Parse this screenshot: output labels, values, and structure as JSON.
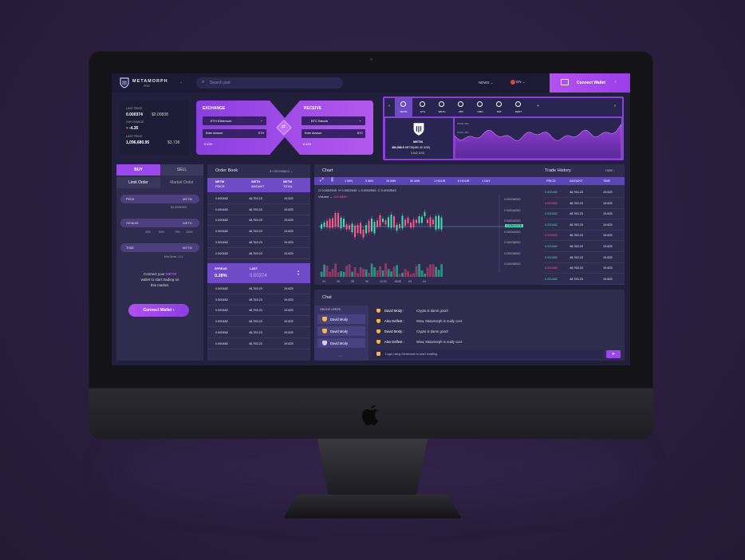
{
  "brand": {
    "name": "METAMORPH",
    "sub": "PRO"
  },
  "topbar": {
    "search_placeholder": "Search pair",
    "news": "NEWS",
    "lang": "EN",
    "connect": "Connect Wallet"
  },
  "stats": {
    "last_price_label": "LAST PRICE",
    "last_price": "0.000374",
    "last_price_usd": "$0.00838",
    "change_label": "24H CHANGE",
    "change": "-4.35",
    "last2_label": "LAST PRICE",
    "last2": "1,096,680.95",
    "last2_usd": "$3,738"
  },
  "exchange": {
    "title": "EXCHANGE",
    "coin": "ETH Ethereum",
    "amount_label": "Enter Amount",
    "amount_unit": "ETH",
    "usd": "$ USD"
  },
  "receive": {
    "title": "RECEIVE",
    "coin": "BTC Bitcoin",
    "amount_label": "Enter Amount",
    "amount_unit": "BTC",
    "usd": "$ USD"
  },
  "tokens": [
    {
      "sym": "METM"
    },
    {
      "sym": "ETH"
    },
    {
      "sym": "WETH"
    },
    {
      "sym": "ZRX"
    },
    {
      "sym": "OMG"
    },
    {
      "sym": "BAT"
    },
    {
      "sym": "DENT"
    }
  ],
  "token_card": {
    "sym": "METM",
    "price": "482,566.9",
    "unit": "METM",
    "usd": "(482.40 USD)",
    "sub": "0.842 USD",
    "levels": [
      "0.000 USD",
      "0.000 USD",
      "0.000 USD"
    ]
  },
  "trade": {
    "buy": "BUY",
    "sell": "SELL",
    "limit": "Limit Order",
    "market": "Market Order",
    "price": "Price",
    "price_unit": "METM",
    "price_val": "$0.00000000",
    "amount": "Amount",
    "amount_unit": "WETH",
    "pct": [
      "25%",
      "50%",
      "75%",
      "100%"
    ],
    "total": "Total",
    "total_unit": "METM",
    "min_order": "Min Order • 0.1",
    "connect_msg1": "Connect your",
    "connect_msg_hl": "METM",
    "connect_msg2": "wallet to start trading on",
    "connect_msg3": "this market.",
    "connect_btn": "Connect Wallet"
  },
  "orderbook": {
    "title": "Order Book",
    "decimals": "8+ DECIMALS",
    "cols": [
      [
        "METM",
        "PRICE"
      ],
      [
        "WETH",
        "AMOUNT"
      ],
      [
        "METM",
        "TOTAL"
      ]
    ],
    "spread_label": "SPREAD",
    "spread": "0.28%",
    "last_label": "LAST",
    "last": "0.00374",
    "row": [
      "0.000482",
      "48,763.23",
      "19.625"
    ]
  },
  "chart": {
    "title": "Chart",
    "intervals": [
      "1 MIN",
      "5 MIN",
      "15 MIN",
      "30 MIN",
      "1 HOUR",
      "6 HOUR",
      "1 DAY"
    ],
    "ohlc": "O 0.0002545  H 0.0002545  L 0.0002545  C 0.0002545",
    "volume": "Volume",
    "volume_val": "109.650K",
    "yticks": [
      "0.000046000",
      "0.000044000",
      "0.000042000",
      "0.000040000",
      "0.000038000",
      "0.000038000",
      "0.000036000"
    ],
    "current": "0.000042100",
    "xticks": [
      "24",
      "26",
      "28",
      "30",
      "12:00",
      "JUNE",
      "03",
      "04"
    ]
  },
  "history": {
    "title": "Trade History",
    "hide": "HIDE",
    "cols": [
      "PRICE",
      "AMOUNT",
      "TIME"
    ],
    "row": [
      "0.000482",
      "48,763.23",
      "19.625"
    ]
  },
  "chat": {
    "title": "Chat",
    "online": "ONLINE USERS",
    "users": [
      "David Mody",
      "David Mody",
      "David Mody"
    ],
    "messages": [
      {
        "user": "David Mody :",
        "text": "Crypto is damn good!"
      },
      {
        "user": "Alex Delfest :",
        "text": "Wow, Metamorph is really cool."
      },
      {
        "user": "David Mody :",
        "text": "Crypto is damn good!"
      },
      {
        "user": "Alex Delfest :",
        "text": "Wow, Metamorph is really cool."
      }
    ],
    "input": "Login using Metamask to start chatting."
  },
  "colors": {
    "accent": "#a44bf0",
    "green": "#3fe0b6",
    "red": "#ff5a8a",
    "panel": "#2f2c4f"
  }
}
